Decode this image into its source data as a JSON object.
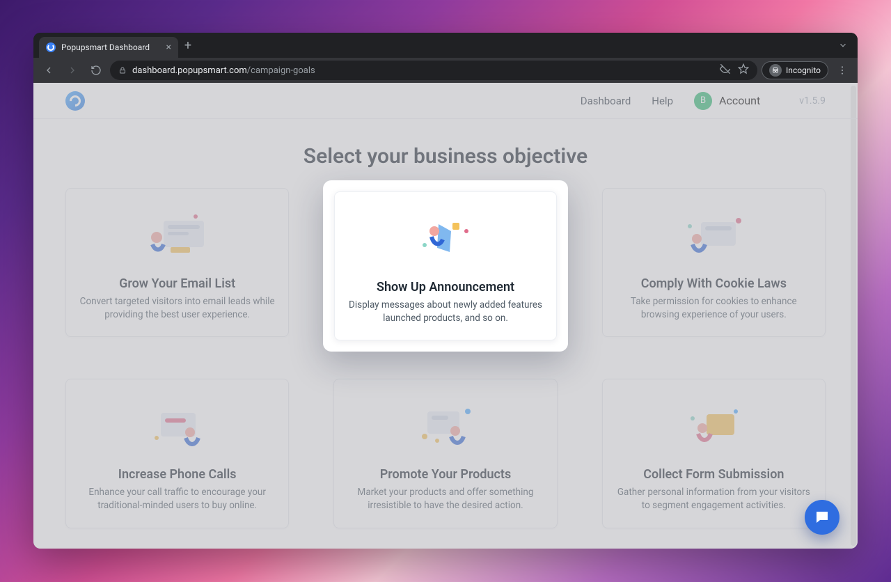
{
  "browser": {
    "tab_title": "Popupsmart Dashboard",
    "url_host": "dashboard.popupsmart.com",
    "url_path": "/campaign-goals",
    "incognito_label": "Incognito"
  },
  "header": {
    "nav": {
      "dashboard": "Dashboard",
      "help": "Help",
      "account": "Account"
    },
    "avatar_letter": "B",
    "version": "v1.5.9"
  },
  "page": {
    "title": "Select your business objective"
  },
  "cards": [
    {
      "title": "Grow Your Email List",
      "desc": "Convert targeted visitors into email leads while providing the best user experience."
    },
    {
      "title": "Show Up Announcement",
      "desc": "Display messages about newly added features launched products, and so on."
    },
    {
      "title": "Comply With Cookie Laws",
      "desc": "Take permission for cookies to enhance browsing experience of your users."
    },
    {
      "title": "Increase Phone Calls",
      "desc": "Enhance your call traffic to encourage your traditional-minded users to buy online."
    },
    {
      "title": "Promote Your Products",
      "desc": "Market your products and offer something irresistible to have the desired action."
    },
    {
      "title": "Collect Form Submission",
      "desc": "Gather personal information from your visitors to segment engagement activities."
    }
  ],
  "highlight_index": 1
}
